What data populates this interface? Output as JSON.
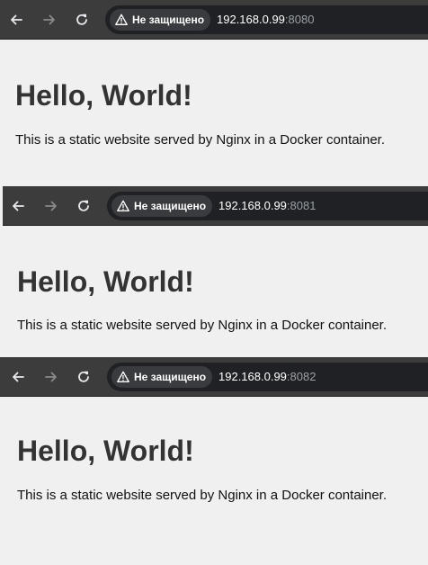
{
  "windows": [
    {
      "security_label": "Не защищено",
      "url_host": "192.168.0.99",
      "url_port": ":8080",
      "heading": "Hello, World!",
      "paragraph": "This is a static website served by Nginx in a Docker container."
    },
    {
      "security_label": "Не защищено",
      "url_host": "192.168.0.99",
      "url_port": ":8081",
      "heading": "Hello, World!",
      "paragraph": "This is a static website served by Nginx in a Docker container."
    },
    {
      "security_label": "Не защищено",
      "url_host": "192.168.0.99",
      "url_port": ":8082",
      "heading": "Hello, World!",
      "paragraph": "This is a static website served by Nginx in a Docker container."
    }
  ],
  "icons": {
    "back": "back-arrow-icon",
    "forward": "forward-arrow-icon",
    "reload": "reload-icon",
    "warning": "warning-triangle-icon"
  },
  "colors": {
    "toolbar": "#3c3c3c",
    "omnibox": "#202124",
    "page_background": "#f0f0f0",
    "heading_text": "#333333"
  }
}
